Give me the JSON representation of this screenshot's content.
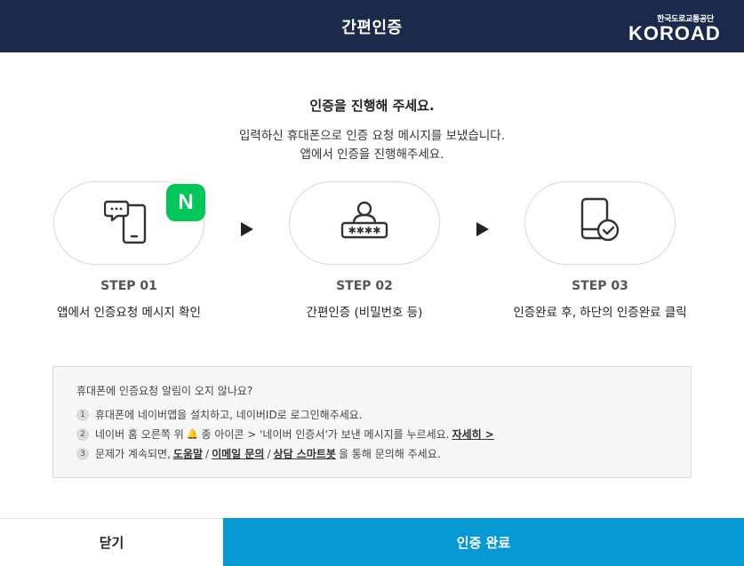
{
  "header": {
    "title": "간편인증",
    "logo_sub": "한국도로교통공단",
    "logo_main": "KOROAD"
  },
  "intro": {
    "title": "인증을 진행해 주세요.",
    "desc_line1": "입력하신 휴대폰으로 인증 요청 메시지를 보냈습니다.",
    "desc_line2": "앱에서 인증을 진행해주세요."
  },
  "steps": [
    {
      "label": "STEP 01",
      "desc": "앱에서 인증요청 메시지 확인",
      "icon": "phone-message-icon",
      "badge": "N"
    },
    {
      "label": "STEP 02",
      "desc": "간편인증 (비밀번호 등)",
      "icon": "user-password-icon"
    },
    {
      "label": "STEP 03",
      "desc": "인증완료 후, 하단의 인증완료 클릭",
      "icon": "phone-check-icon"
    }
  ],
  "help": {
    "title": "휴대폰에 인증요청 알림이 오지 않나요?",
    "item1_num": "1",
    "item1_text": "휴대폰에 네이버앱을 설치하고, 네이버ID로 로그인해주세요.",
    "item2_num": "2",
    "item2_text_a": "네이버 홈 오른쪽 위",
    "item2_text_b": "종 아이콘 > '네이버 인증서'가 보낸 메시지를 누르세요.",
    "item2_link": "자세히 >",
    "item3_num": "3",
    "item3_text_a": "문제가 계속되면,",
    "item3_link1": "도움말",
    "item3_sep1": "/",
    "item3_link2": "이메일 문의",
    "item3_sep2": "/",
    "item3_link3": "상담 스마트봇",
    "item3_text_b": "을 통해 문의해 주세요."
  },
  "footer": {
    "close_label": "닫기",
    "done_label": "인증 완료"
  },
  "colors": {
    "header_bg": "#1b2a4a",
    "primary": "#0699d3",
    "naver_green": "#03c75a"
  }
}
